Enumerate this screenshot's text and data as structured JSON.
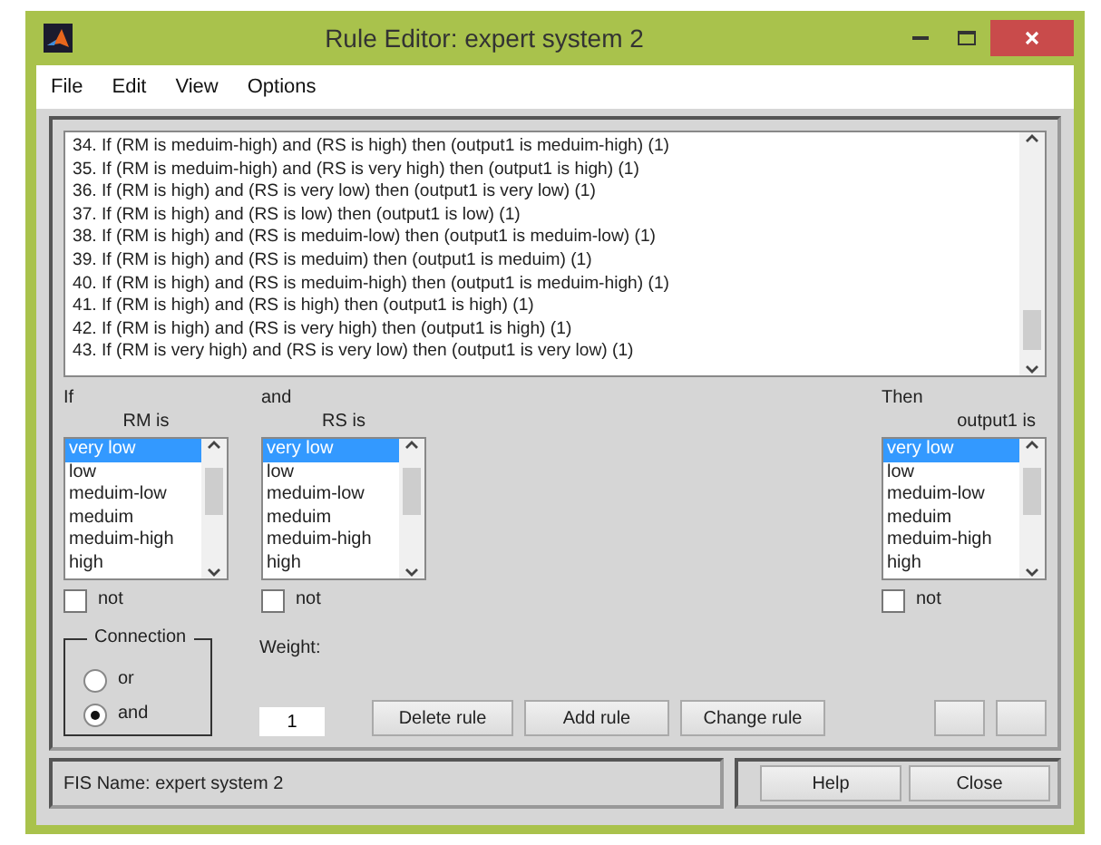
{
  "window": {
    "title": "Rule Editor: expert system 2"
  },
  "menu": [
    "File",
    "Edit",
    "View",
    "Options"
  ],
  "rules": [
    "34. If (RM is meduim-high) and (RS is high) then (output1 is meduim-high) (1)",
    "35. If (RM is meduim-high) and (RS is very high) then (output1 is high) (1)",
    "36. If (RM is high) and (RS is very low) then (output1 is very low) (1)",
    "37. If (RM is high) and (RS is low) then (output1 is low) (1)",
    "38. If (RM is high) and (RS is meduim-low) then (output1 is meduim-low) (1)",
    "39. If (RM is high) and (RS is meduim) then (output1 is meduim) (1)",
    "40. If (RM is high) and (RS is meduim-high) then (output1 is meduim-high) (1)",
    "41. If (RM is high) and (RS is high) then (output1 is high) (1)",
    "42. If (RM is high) and (RS is very high) then (output1 is high) (1)",
    "43. If (RM is very high) and (RS is very low) then (output1 is very low) (1)"
  ],
  "variables": [
    {
      "kind": "input",
      "prefix": "If",
      "label": "RM is",
      "not_label": "not",
      "not": false,
      "options": [
        {
          "label": "very low",
          "selected": true
        },
        {
          "label": "low",
          "selected": false
        },
        {
          "label": "meduim-low",
          "selected": false
        },
        {
          "label": "meduim",
          "selected": false
        },
        {
          "label": "meduim-high",
          "selected": false
        },
        {
          "label": "high",
          "selected": false
        }
      ]
    },
    {
      "kind": "input",
      "prefix": "and",
      "label": "RS is",
      "not_label": "not",
      "not": false,
      "options": [
        {
          "label": "very low",
          "selected": true
        },
        {
          "label": "low",
          "selected": false
        },
        {
          "label": "meduim-low",
          "selected": false
        },
        {
          "label": "meduim",
          "selected": false
        },
        {
          "label": "meduim-high",
          "selected": false
        },
        {
          "label": "high",
          "selected": false
        }
      ]
    },
    {
      "kind": "output",
      "prefix": "Then",
      "label": "output1 is",
      "not_label": "not",
      "not": false,
      "options": [
        {
          "label": "very low",
          "selected": true
        },
        {
          "label": "low",
          "selected": false
        },
        {
          "label": "meduim-low",
          "selected": false
        },
        {
          "label": "meduim",
          "selected": false
        },
        {
          "label": "meduim-high",
          "selected": false
        },
        {
          "label": "high",
          "selected": false
        }
      ]
    }
  ],
  "connection": {
    "title": "Connection",
    "options": [
      {
        "label": "or",
        "selected": false
      },
      {
        "label": "and",
        "selected": true
      }
    ]
  },
  "weight": {
    "label": "Weight:",
    "value": "1"
  },
  "buttons": [
    "Delete rule",
    "Add rule",
    "Change rule"
  ],
  "status": "FIS Name: expert system 2",
  "footer_buttons": [
    "Help",
    "Close"
  ]
}
